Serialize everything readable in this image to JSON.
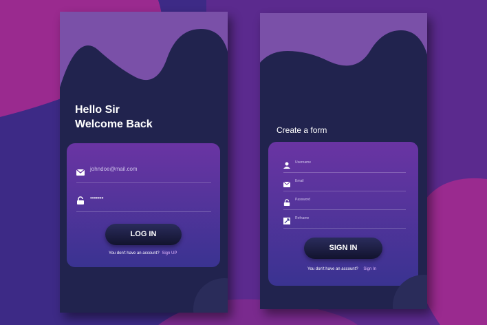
{
  "colors": {
    "background": "#5b2a8e",
    "card": "#21234e",
    "wave": "#7a50a8",
    "form_top": "#6a34a3",
    "form_bottom": "#3a3391",
    "accent_pink": "#9a2a8f"
  },
  "login": {
    "greeting_line1": "Hello Sir",
    "greeting_line2": "Welcome Back",
    "email": {
      "value": "johndoe@mail.com",
      "icon": "mail-icon"
    },
    "password": {
      "value": "•••••••",
      "icon": "lock-icon"
    },
    "button_label": "LOG IN",
    "footer_text": "You don't have an account?",
    "footer_link": "Sign UP"
  },
  "signup": {
    "title": "Create a form",
    "fields": [
      {
        "placeholder": "Username",
        "icon": "user-icon"
      },
      {
        "placeholder": "Email",
        "icon": "mail-icon"
      },
      {
        "placeholder": "Password",
        "icon": "lock-icon"
      },
      {
        "placeholder": "Refname",
        "icon": "image-icon"
      }
    ],
    "button_label": "SIGN IN",
    "footer_text": "You don't have an account?",
    "footer_link": "Sign In"
  }
}
